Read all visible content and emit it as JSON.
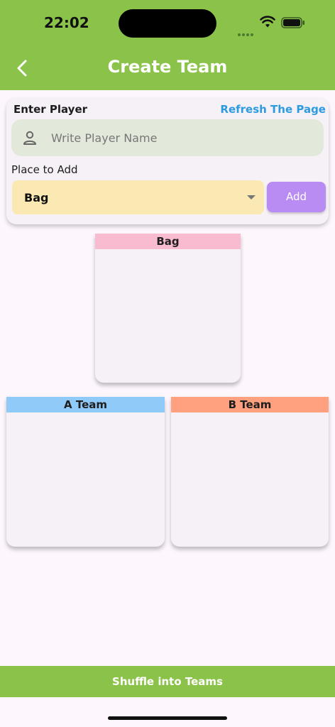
{
  "status_bar": {
    "time": "22:02"
  },
  "app_bar": {
    "title": "Create Team",
    "back_icon": "chevron-left-icon",
    "color": "#8bc34a"
  },
  "form": {
    "enter_player_label": "Enter Player",
    "refresh_label": "Refresh The Page",
    "player_input": {
      "placeholder": "Write Player Name",
      "value": "",
      "icon": "person-icon"
    },
    "place_label": "Place to Add",
    "place_select": {
      "selected": "Bag"
    },
    "add_label": "Add"
  },
  "boxes": {
    "bag": {
      "title": "Bag",
      "color": "#f8bbd0"
    },
    "a_team": {
      "title": "A Team",
      "color": "#90caf9"
    },
    "b_team": {
      "title": "B Team",
      "color": "#ffa07f"
    }
  },
  "shuffle_label": "Shuffle into Teams"
}
